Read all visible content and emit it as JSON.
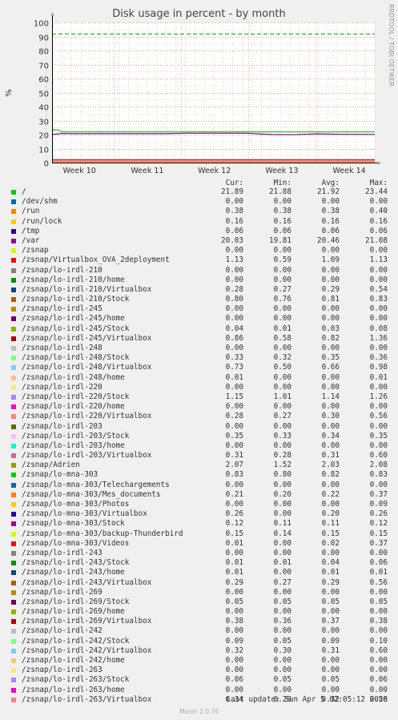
{
  "chart_data": {
    "type": "line",
    "title": "Disk usage in percent - by month",
    "ylabel": "%",
    "ylim": [
      0,
      100
    ],
    "yticks": [
      0,
      10,
      20,
      30,
      40,
      50,
      60,
      70,
      80,
      90,
      100
    ],
    "xticks": [
      "Week 10",
      "Week 11",
      "Week 12",
      "Week 13",
      "Week 14"
    ],
    "reference_line": {
      "value": 92,
      "color": "#00aa00"
    },
    "series_lines": [
      {
        "name": "/",
        "color": "#00cc00",
        "points": [
          [
            0,
            23.4
          ],
          [
            0.02,
            23.3
          ],
          [
            0.03,
            21.9
          ],
          [
            1,
            21.9
          ]
        ]
      },
      {
        "name": "/var",
        "color": "#990099",
        "points": [
          [
            0,
            20.0
          ],
          [
            0.03,
            20.8
          ],
          [
            0.06,
            20.6
          ],
          [
            0.35,
            20.6
          ],
          [
            0.42,
            21.0
          ],
          [
            0.6,
            21.0
          ],
          [
            0.68,
            20.0
          ],
          [
            0.75,
            19.9
          ],
          [
            0.82,
            20.5
          ],
          [
            0.9,
            20.2
          ],
          [
            1,
            20.1
          ]
        ]
      },
      {
        "name": "/zsnap/Adrien",
        "color": "#ff0000",
        "points": [
          [
            0,
            2.0
          ],
          [
            1,
            2.0
          ]
        ]
      },
      {
        "name": "/zsnap/lo-irdl-220/Stock",
        "color": "#cc66cc",
        "points": [
          [
            0,
            1.1
          ],
          [
            1,
            1.1
          ]
        ]
      }
    ],
    "columns": [
      "Cur:",
      "Min:",
      "Avg:",
      "Max:"
    ],
    "series": [
      {
        "name": "/",
        "color": "#00cc00",
        "values": [
          "21.89",
          "21.88",
          "21.92",
          "23.44"
        ]
      },
      {
        "name": "/dev/shm",
        "color": "#0066b3",
        "values": [
          "0.00",
          "0.00",
          "0.00",
          "0.00"
        ]
      },
      {
        "name": "/run",
        "color": "#ff8000",
        "values": [
          "0.38",
          "0.38",
          "0.38",
          "0.40"
        ]
      },
      {
        "name": "/run/lock",
        "color": "#ffcc00",
        "values": [
          "0.16",
          "0.16",
          "0.16",
          "0.16"
        ]
      },
      {
        "name": "/tmp",
        "color": "#330099",
        "values": [
          "0.06",
          "0.06",
          "0.06",
          "0.06"
        ]
      },
      {
        "name": "/var",
        "color": "#990099",
        "values": [
          "20.03",
          "19.81",
          "20.46",
          "21.08"
        ]
      },
      {
        "name": "/zsnap",
        "color": "#ccff00",
        "values": [
          "0.00",
          "0.00",
          "0.00",
          "0.00"
        ]
      },
      {
        "name": "/zsnap/Virtualbox_OVA_2deployment",
        "color": "#ff0000",
        "values": [
          "1.13",
          "0.59",
          "1.09",
          "1.13"
        ]
      },
      {
        "name": "/zsnap/lo-irdl-210",
        "color": "#808080",
        "values": [
          "0.00",
          "0.00",
          "0.00",
          "0.00"
        ]
      },
      {
        "name": "/zsnap/lo-irdl-210/home",
        "color": "#008f00",
        "values": [
          "0.00",
          "0.00",
          "0.00",
          "0.00"
        ]
      },
      {
        "name": "/zsnap/lo-irdl-210/Virtualbox",
        "color": "#00487d",
        "values": [
          "0.28",
          "0.27",
          "0.29",
          "0.54"
        ]
      },
      {
        "name": "/zsnap/lo-irdl-210/Stock",
        "color": "#b35a00",
        "values": [
          "0.80",
          "0.76",
          "0.81",
          "0.83"
        ]
      },
      {
        "name": "/zsnap/lo-irdl-245",
        "color": "#b38f00",
        "values": [
          "0.00",
          "0.00",
          "0.00",
          "0.00"
        ]
      },
      {
        "name": "/zsnap/lo-irdl-245/home",
        "color": "#6b006b",
        "values": [
          "0.00",
          "0.00",
          "0.00",
          "0.00"
        ]
      },
      {
        "name": "/zsnap/lo-irdl-245/Stock",
        "color": "#8fb300",
        "values": [
          "0.04",
          "0.01",
          "0.03",
          "0.08"
        ]
      },
      {
        "name": "/zsnap/lo-irdl-245/Virtualbox",
        "color": "#b30000",
        "values": [
          "0.86",
          "0.58",
          "0.82",
          "1.36"
        ]
      },
      {
        "name": "/zsnap/lo-irdl-248",
        "color": "#bebebe",
        "values": [
          "0.00",
          "0.00",
          "0.00",
          "0.00"
        ]
      },
      {
        "name": "/zsnap/lo-irdl-248/Stock",
        "color": "#80ff80",
        "values": [
          "0.33",
          "0.32",
          "0.35",
          "0.36"
        ]
      },
      {
        "name": "/zsnap/lo-irdl-248/Virtualbox",
        "color": "#80c9ff",
        "values": [
          "0.73",
          "0.50",
          "0.66",
          "0.98"
        ]
      },
      {
        "name": "/zsnap/lo-irdl-248/home",
        "color": "#ffc080",
        "values": [
          "0.01",
          "0.00",
          "0.00",
          "0.01"
        ]
      },
      {
        "name": "/zsnap/lo-irdl-220",
        "color": "#ffe680",
        "values": [
          "0.00",
          "0.00",
          "0.00",
          "0.00"
        ]
      },
      {
        "name": "/zsnap/lo-irdl-220/Stock",
        "color": "#aa80ff",
        "values": [
          "1.15",
          "1.01",
          "1.14",
          "1.26"
        ]
      },
      {
        "name": "/zsnap/lo-irdl-220/home",
        "color": "#ee00cc",
        "values": [
          "0.00",
          "0.00",
          "0.00",
          "0.00"
        ]
      },
      {
        "name": "/zsnap/lo-irdl-220/Virtualbox",
        "color": "#ff8080",
        "values": [
          "0.28",
          "0.27",
          "0.30",
          "0.56"
        ]
      },
      {
        "name": "/zsnap/lo-irdl-203",
        "color": "#666600",
        "values": [
          "0.00",
          "0.00",
          "0.00",
          "0.00"
        ]
      },
      {
        "name": "/zsnap/lo-irdl-203/Stock",
        "color": "#ffbfff",
        "values": [
          "0.35",
          "0.33",
          "0.34",
          "0.35"
        ]
      },
      {
        "name": "/zsnap/lo-irdl-203/home",
        "color": "#00ffcc",
        "values": [
          "0.00",
          "0.00",
          "0.00",
          "0.00"
        ]
      },
      {
        "name": "/zsnap/lo-irdl-203/Virtualbox",
        "color": "#cc6699",
        "values": [
          "0.31",
          "0.28",
          "0.31",
          "0.60"
        ]
      },
      {
        "name": "/zsnap/Adrien",
        "color": "#999900",
        "values": [
          "2.07",
          "1.52",
          "2.03",
          "2.08"
        ]
      },
      {
        "name": "/zsnap/lo-mna-303",
        "color": "#00cc00",
        "values": [
          "0.83",
          "0.80",
          "0.82",
          "0.83"
        ]
      },
      {
        "name": "/zsnap/lo-mna-303/Telechargements",
        "color": "#0066b3",
        "values": [
          "0.00",
          "0.00",
          "0.00",
          "0.00"
        ]
      },
      {
        "name": "/zsnap/lo-mna-303/Mes_documents",
        "color": "#ff8000",
        "values": [
          "0.21",
          "0.20",
          "0.22",
          "0.37"
        ]
      },
      {
        "name": "/zsnap/lo-mna-303/Photos",
        "color": "#ffcc00",
        "values": [
          "0.00",
          "0.00",
          "0.00",
          "0.09"
        ]
      },
      {
        "name": "/zsnap/lo-mna-303/Virtualbox",
        "color": "#330099",
        "values": [
          "0.26",
          "0.00",
          "0.20",
          "0.26"
        ]
      },
      {
        "name": "/zsnap/lo-mna-303/Stock",
        "color": "#990099",
        "values": [
          "0.12",
          "0.11",
          "0.11",
          "0.12"
        ]
      },
      {
        "name": "/zsnap/lo-mna-303/backup-Thunderbird",
        "color": "#ccff00",
        "values": [
          "0.15",
          "0.14",
          "0.15",
          "0.15"
        ]
      },
      {
        "name": "/zsnap/lo-mna-303/Videos",
        "color": "#ff0000",
        "values": [
          "0.01",
          "0.00",
          "0.02",
          "0.37"
        ]
      },
      {
        "name": "/zsnap/lo-irdl-243",
        "color": "#808080",
        "values": [
          "0.00",
          "0.00",
          "0.00",
          "0.00"
        ]
      },
      {
        "name": "/zsnap/lo-irdl-243/Stock",
        "color": "#008f00",
        "values": [
          "0.01",
          "0.01",
          "0.04",
          "0.06"
        ]
      },
      {
        "name": "/zsnap/lo-irdl-243/home",
        "color": "#00487d",
        "values": [
          "0.01",
          "0.00",
          "0.01",
          "0.01"
        ]
      },
      {
        "name": "/zsnap/lo-irdl-243/Virtualbox",
        "color": "#b35a00",
        "values": [
          "0.29",
          "0.27",
          "0.29",
          "0.56"
        ]
      },
      {
        "name": "/zsnap/lo-irdl-269",
        "color": "#b38f00",
        "values": [
          "0.00",
          "0.00",
          "0.00",
          "0.00"
        ]
      },
      {
        "name": "/zsnap/lo-irdl-269/Stock",
        "color": "#6b006b",
        "values": [
          "0.05",
          "0.05",
          "0.05",
          "0.05"
        ]
      },
      {
        "name": "/zsnap/lo-irdl-269/home",
        "color": "#8fb300",
        "values": [
          "0.00",
          "0.00",
          "0.00",
          "0.00"
        ]
      },
      {
        "name": "/zsnap/lo-irdl-269/Virtualbox",
        "color": "#b30000",
        "values": [
          "0.38",
          "0.36",
          "0.37",
          "0.38"
        ]
      },
      {
        "name": "/zsnap/lo-irdl-242",
        "color": "#bebebe",
        "values": [
          "0.00",
          "0.00",
          "0.00",
          "0.00"
        ]
      },
      {
        "name": "/zsnap/lo-irdl-242/Stock",
        "color": "#80ff80",
        "values": [
          "0.09",
          "0.05",
          "0.09",
          "0.10"
        ]
      },
      {
        "name": "/zsnap/lo-irdl-242/Virtualbox",
        "color": "#80c9ff",
        "values": [
          "0.32",
          "0.30",
          "0.31",
          "0.60"
        ]
      },
      {
        "name": "/zsnap/lo-irdl-242/home",
        "color": "#ffc080",
        "values": [
          "0.00",
          "0.00",
          "0.00",
          "0.00"
        ]
      },
      {
        "name": "/zsnap/lo-irdl-263",
        "color": "#ffe680",
        "values": [
          "0.00",
          "0.00",
          "0.00",
          "0.00"
        ]
      },
      {
        "name": "/zsnap/lo-irdl-263/Stock",
        "color": "#aa80ff",
        "values": [
          "0.06",
          "0.05",
          "0.05",
          "0.06"
        ]
      },
      {
        "name": "/zsnap/lo-irdl-263/home",
        "color": "#ee00cc",
        "values": [
          "0.00",
          "0.00",
          "0.00",
          "0.00"
        ]
      },
      {
        "name": "/zsnap/lo-irdl-263/Virtualbox",
        "color": "#ff8080",
        "values": [
          "0.34",
          "0.29",
          "0.32",
          "0.58"
        ]
      }
    ]
  },
  "side_label": "RRDTOOL / TOBI OETIKER",
  "last_update": "Last update: Sun Apr  5 02:05:12 2026",
  "footer": "Munin 2.0.76"
}
